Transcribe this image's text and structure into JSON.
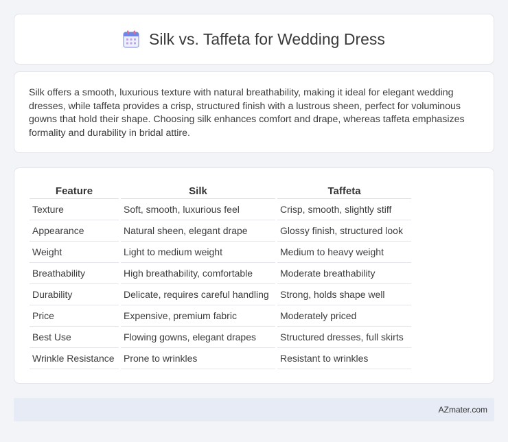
{
  "header": {
    "title": "Silk vs. Taffeta for Wedding Dress",
    "icon": "calendar-icon"
  },
  "summary": {
    "text": "Silk offers a smooth, luxurious texture with natural breathability, making it ideal for elegant wedding dresses, while taffeta provides a crisp, structured finish with a lustrous sheen, perfect for voluminous gowns that hold their shape. Choosing silk enhances comfort and drape, whereas taffeta emphasizes formality and durability in bridal attire."
  },
  "table": {
    "headers": [
      "Feature",
      "Silk",
      "Taffeta"
    ],
    "rows": [
      [
        "Texture",
        "Soft, smooth, luxurious feel",
        "Crisp, smooth, slightly stiff"
      ],
      [
        "Appearance",
        "Natural sheen, elegant drape",
        "Glossy finish, structured look"
      ],
      [
        "Weight",
        "Light to medium weight",
        "Medium to heavy weight"
      ],
      [
        "Breathability",
        "High breathability, comfortable",
        "Moderate breathability"
      ],
      [
        "Durability",
        "Delicate, requires careful handling",
        "Strong, holds shape well"
      ],
      [
        "Price",
        "Expensive, premium fabric",
        "Moderately priced"
      ],
      [
        "Best Use",
        "Flowing gowns, elegant drapes",
        "Structured dresses, full skirts"
      ],
      [
        "Wrinkle Resistance",
        "Prone to wrinkles",
        "Resistant to wrinkles"
      ]
    ]
  },
  "footer": {
    "text": "AZmater.com"
  },
  "colors": {
    "background": "#f3f4f8",
    "card": "#ffffff",
    "footer": "#e7ebf5",
    "icon_accent": "#7b8cde"
  }
}
